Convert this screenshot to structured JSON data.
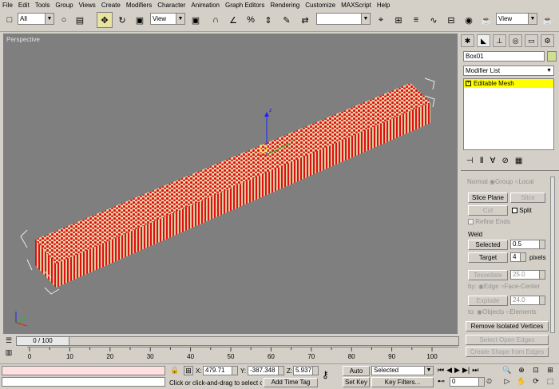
{
  "menu": [
    "File",
    "Edit",
    "Tools",
    "Group",
    "Views",
    "Create",
    "Modifiers",
    "Character",
    "Animation",
    "Graph Editors",
    "Rendering",
    "Customize",
    "MAXScript",
    "Help"
  ],
  "toolbar": {
    "selection_filter": "All",
    "ref_coord": "View",
    "named_sel": "",
    "view_right": "View",
    "snap_num": "3",
    "percent_num": "%"
  },
  "viewport": {
    "label": "Perspective",
    "gizmo_z": "z",
    "gizmo_y": "y",
    "gizmo_x": "x"
  },
  "panel": {
    "object_name": "Box01",
    "modifier_list": "Modifier List",
    "stack_item": "Editable Mesh",
    "normal_label": "Normal",
    "group_label": "Group",
    "local_label": "Local",
    "slice_plane": "Slice Plane",
    "slice": "Slice",
    "cut": "Cut",
    "split": "Split",
    "refine_ends": "Refine Ends",
    "weld_title": "Weld",
    "selected_btn": "Selected",
    "selected_val": "0.5",
    "target_btn": "Target",
    "target_val": "4",
    "pixels": "pixels",
    "tessellate": "Tessellate",
    "tessellate_val": "25.0",
    "by_label": "by:",
    "edge_label": "Edge",
    "face_center": "Face-Center",
    "explode": "Explode",
    "explode_val": "24.0",
    "to_label": "to:",
    "objects_label": "Objects",
    "elements_label": "Elements",
    "remove_isolated": "Remove Isolated Vertices",
    "select_open_edges": "Select Open Edges",
    "create_shape": "Create Shape from Edges"
  },
  "timeline": {
    "frame_display": "0 / 100",
    "ticks": [
      "0",
      "10",
      "20",
      "30",
      "40",
      "50",
      "60",
      "70",
      "80",
      "90",
      "100"
    ]
  },
  "status": {
    "x_label": "X:",
    "x_val": "479.71",
    "y_label": "Y:",
    "y_val": "-387.348",
    "z_label": "Z:",
    "z_val": "5.937",
    "prompt": "Click or click-and-drag to select obj",
    "add_time_tag": "Add Time Tag",
    "auto_key": "Auto Key",
    "set_key": "Set Key",
    "selected_dropdown": "Selected",
    "key_filters": "Key Filters...",
    "frame_field": "0"
  },
  "colors": {
    "viewport_bg": "#7f7f7f",
    "mesh_red": "#e01010",
    "mesh_cream": "#e8dcb0",
    "stack_yellow": "#ffff00"
  }
}
